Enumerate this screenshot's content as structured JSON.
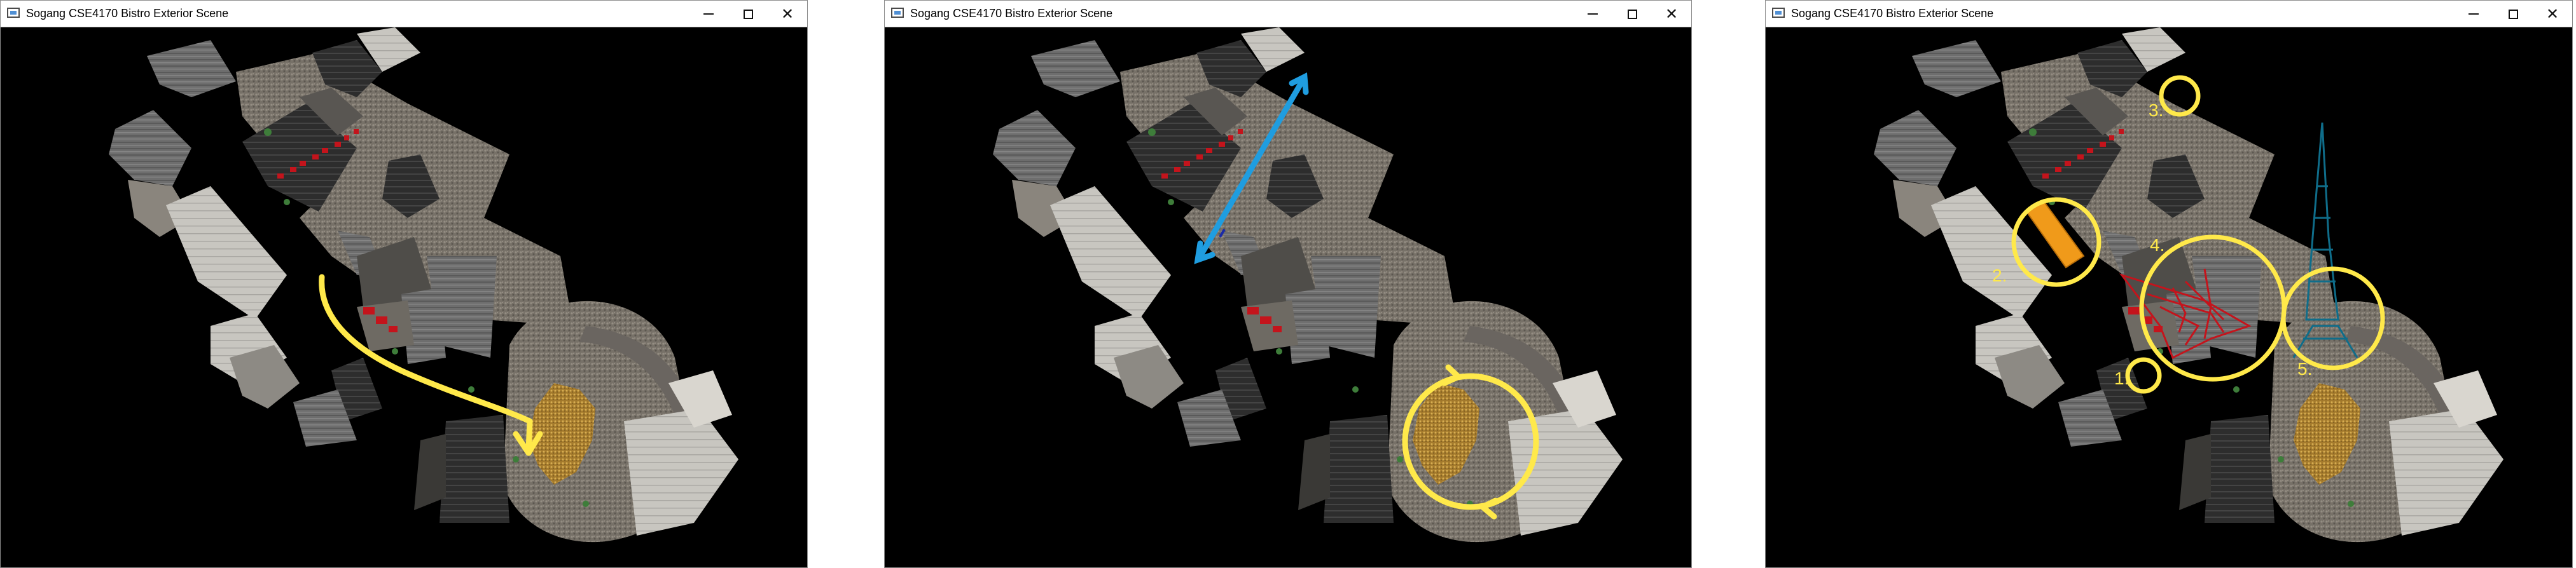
{
  "windows": [
    {
      "title": "Sogang CSE4170 Bistro Exterior Scene",
      "annotation": "yellow-walk-path"
    },
    {
      "title": "Sogang CSE4170 Bistro Exterior Scene",
      "annotation": "blue-double-arrow-and-yellow-circle"
    },
    {
      "title": "Sogang CSE4170 Bistro Exterior Scene",
      "labels": [
        "1.",
        "2.",
        "3.",
        "4.",
        "5."
      ]
    }
  ],
  "colors": {
    "annotation_yellow": "#ffe94a",
    "annotation_blue": "#1f9de0",
    "object_orange": "#f09a1a",
    "object_red": "#c4141c",
    "object_teal": "#0f6d8a",
    "fountain_gold": "#c79a3a"
  },
  "icons": {
    "app": "window-app-icon",
    "minimize": "minimize-icon",
    "maximize": "maximize-icon",
    "close": "close-icon"
  }
}
